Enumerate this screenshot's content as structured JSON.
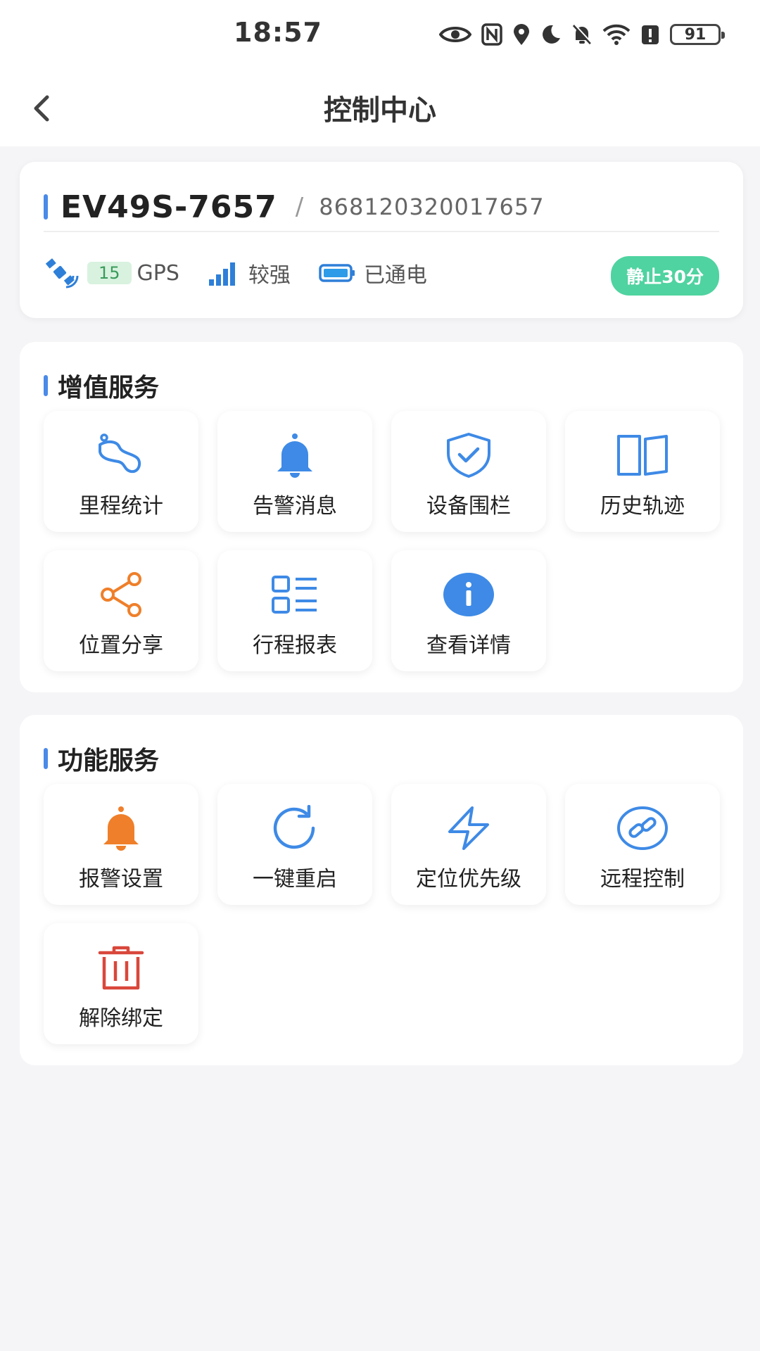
{
  "status_bar": {
    "time": "18:57",
    "battery": "91",
    "icons": [
      "eye-icon",
      "nfc-icon",
      "location-icon",
      "moon-icon",
      "bell-off-icon",
      "wifi-icon",
      "alert-icon",
      "battery-icon"
    ]
  },
  "nav": {
    "title": "控制中心",
    "back_icon": "chevron-left-icon"
  },
  "device": {
    "name": "EV49S-7657",
    "separator": "/",
    "imei": "868120320017657",
    "gps_count": "15",
    "gps_label": "GPS",
    "signal_label": "较强",
    "power_label": "已通电",
    "status_badge": "静止30分"
  },
  "value_services": {
    "title": "增值服务",
    "items": [
      {
        "label": "里程统计",
        "icon": "mileage-icon"
      },
      {
        "label": "告警消息",
        "icon": "bell-icon"
      },
      {
        "label": "设备围栏",
        "icon": "shield-check-icon"
      },
      {
        "label": "历史轨迹",
        "icon": "map-book-icon"
      },
      {
        "label": "位置分享",
        "icon": "share-icon"
      },
      {
        "label": "行程报表",
        "icon": "list-icon"
      },
      {
        "label": "查看详情",
        "icon": "info-icon"
      }
    ]
  },
  "function_services": {
    "title": "功能服务",
    "items": [
      {
        "label": "报警设置",
        "icon": "alarm-bell-icon"
      },
      {
        "label": "一键重启",
        "icon": "refresh-icon"
      },
      {
        "label": "定位优先级",
        "icon": "lightning-icon"
      },
      {
        "label": "远程控制",
        "icon": "link-icon"
      },
      {
        "label": "解除绑定",
        "icon": "trash-icon"
      }
    ]
  },
  "colors": {
    "accent": "#4a8ae8",
    "badge": "#4fd3a0",
    "orange": "#ef7f2a",
    "red": "#d9473b"
  }
}
